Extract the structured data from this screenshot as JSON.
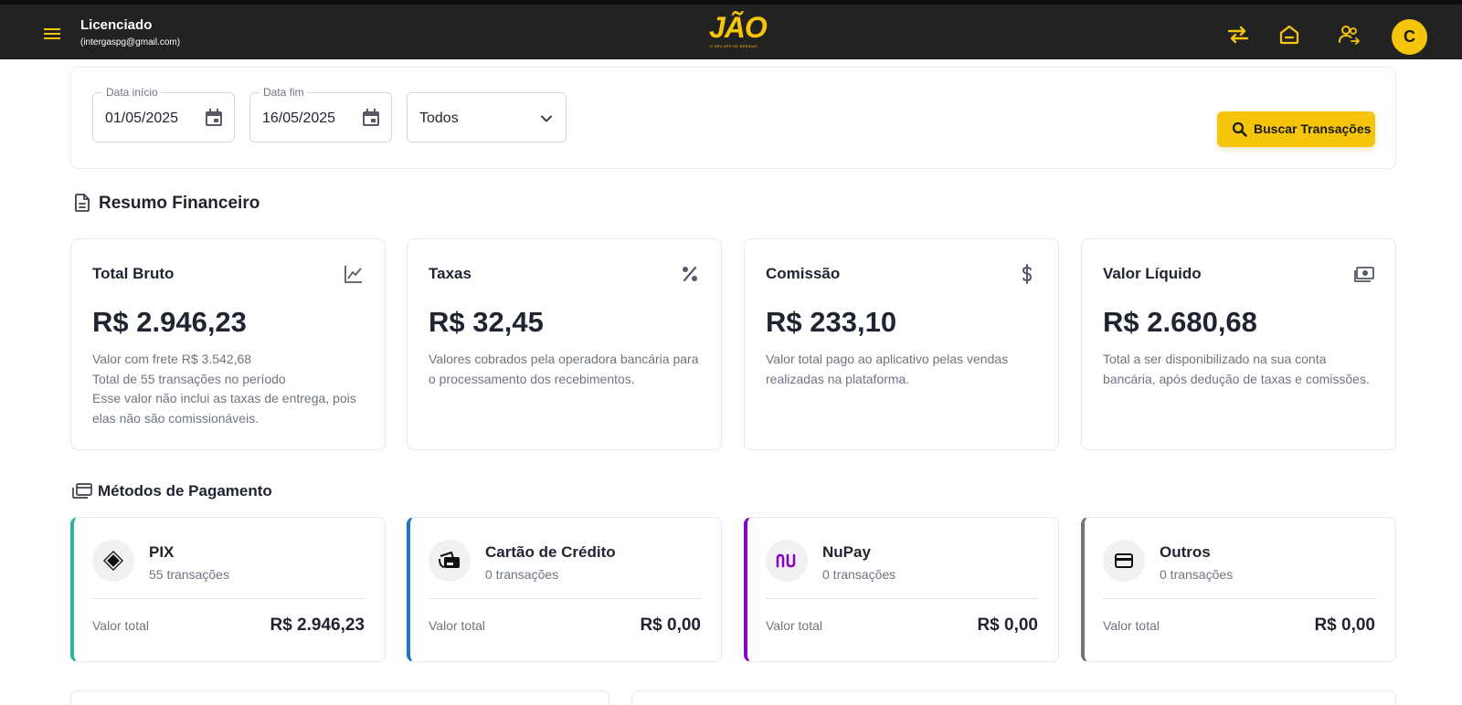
{
  "header": {
    "user_name": "Licenciado",
    "user_email": "(intergaspg@gmail.com)",
    "logo_text": "JÃO",
    "logo_tagline": "O SEU APP DE BEBIDAS",
    "avatar_initial": "C",
    "accent_color": "#f5c50c",
    "bar_color": "#222222",
    "icons": [
      "menu-icon",
      "transfer-icon",
      "home-icon",
      "users-icon"
    ]
  },
  "filters": {
    "start_date": {
      "label": "Data início",
      "value": "01/05/2025"
    },
    "end_date": {
      "label": "Data fim",
      "value": "16/05/2025"
    },
    "type_select": {
      "value": "Todos"
    },
    "search_button": "Buscar Transações"
  },
  "summary": {
    "title": "Resumo Financeiro",
    "cards": [
      {
        "title": "Total Bruto",
        "icon": "chart-line-icon",
        "amount": "R$ 2.946,23",
        "lines": [
          "Valor com frete R$ 3.542,68",
          "Total de 55 transações no período",
          "Esse valor não inclui as taxas de entrega, pois",
          "elas não são comissionáveis."
        ]
      },
      {
        "title": "Taxas",
        "icon": "percent-icon",
        "amount": "R$ 32,45",
        "lines": [
          "Valores cobrados pela operadora bancária para",
          "o processamento dos recebimentos."
        ]
      },
      {
        "title": "Comissão",
        "icon": "dollar-icon",
        "amount": "R$ 233,10",
        "lines": [
          "Valor total pago ao aplicativo pelas vendas",
          "realizadas na plataforma."
        ]
      },
      {
        "title": "Valor Líquido",
        "icon": "money-icon",
        "amount": "R$ 2.680,68",
        "lines": [
          "Total a ser disponibilizado na sua conta",
          "bancária, após dedução de taxas e comissões."
        ]
      }
    ]
  },
  "payments": {
    "title": "Métodos de Pagamento",
    "total_label": "Valor total",
    "methods": [
      {
        "name": "PIX",
        "count": "55 transações",
        "total": "R$ 2.946,23",
        "accent": "#2ab39b",
        "icon": "pix-icon"
      },
      {
        "name": "Cartão de Crédito",
        "count": "0 transações",
        "total": "R$ 0,00",
        "accent": "#1e73c8",
        "icon": "credit-card-icon"
      },
      {
        "name": "NuPay",
        "count": "0 transações",
        "total": "R$ 0,00",
        "accent": "#8a05be",
        "icon": "nubank-icon"
      },
      {
        "name": "Outros",
        "count": "0 transações",
        "total": "R$ 0,00",
        "accent": "#757575",
        "icon": "card-icon"
      }
    ]
  }
}
